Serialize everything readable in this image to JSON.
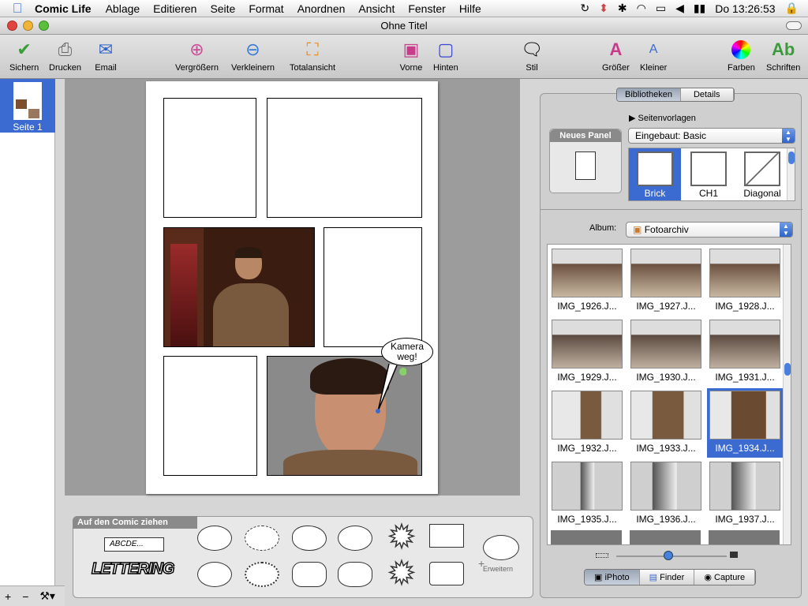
{
  "menubar": {
    "app": "Comic Life",
    "items": [
      "Ablage",
      "Editieren",
      "Seite",
      "Format",
      "Anordnen",
      "Ansicht",
      "Fenster",
      "Hilfe"
    ],
    "clock": "Do 13:26:53"
  },
  "window": {
    "title": "Ohne Titel"
  },
  "toolbar": {
    "sichern": "Sichern",
    "drucken": "Drucken",
    "email": "Email",
    "vergroessern": "Vergrößern",
    "verkleinern": "Verkleinern",
    "totalansicht": "Totalansicht",
    "vorne": "Vorne",
    "hinten": "Hinten",
    "stil": "Stil",
    "groesser": "Größer",
    "kleiner": "Kleiner",
    "farben": "Farben",
    "schriften": "Schriften"
  },
  "sidebar": {
    "page_label": "Seite 1"
  },
  "comic": {
    "bubble_text_1": "Kamera",
    "bubble_text_2": "weg!"
  },
  "elements": {
    "title": "Auf den Comic ziehen",
    "text_sample": "ABCDE...",
    "lettering": "LETTERING",
    "erweitern": "Erweitern"
  },
  "library": {
    "tabs": [
      "Bibliotheken",
      "Details"
    ],
    "seitenvorlagen": "Seitenvorlagen",
    "neues_panel": "Neues Panel",
    "template_select": "Eingebaut: Basic",
    "templates": [
      "Brick",
      "CH1",
      "Diagonal"
    ],
    "album_label": "Album:",
    "album_value": "Fotoarchiv",
    "photos": [
      "IMG_1926.J...",
      "IMG_1927.J...",
      "IMG_1928.J...",
      "IMG_1929.J...",
      "IMG_1930.J...",
      "IMG_1931.J...",
      "IMG_1932.J...",
      "IMG_1933.J...",
      "IMG_1934.J...",
      "IMG_1935.J...",
      "IMG_1936.J...",
      "IMG_1937.J..."
    ],
    "sources": [
      "iPhoto",
      "Finder",
      "Capture"
    ]
  },
  "colors": {
    "accent": "#3b6ad0"
  }
}
